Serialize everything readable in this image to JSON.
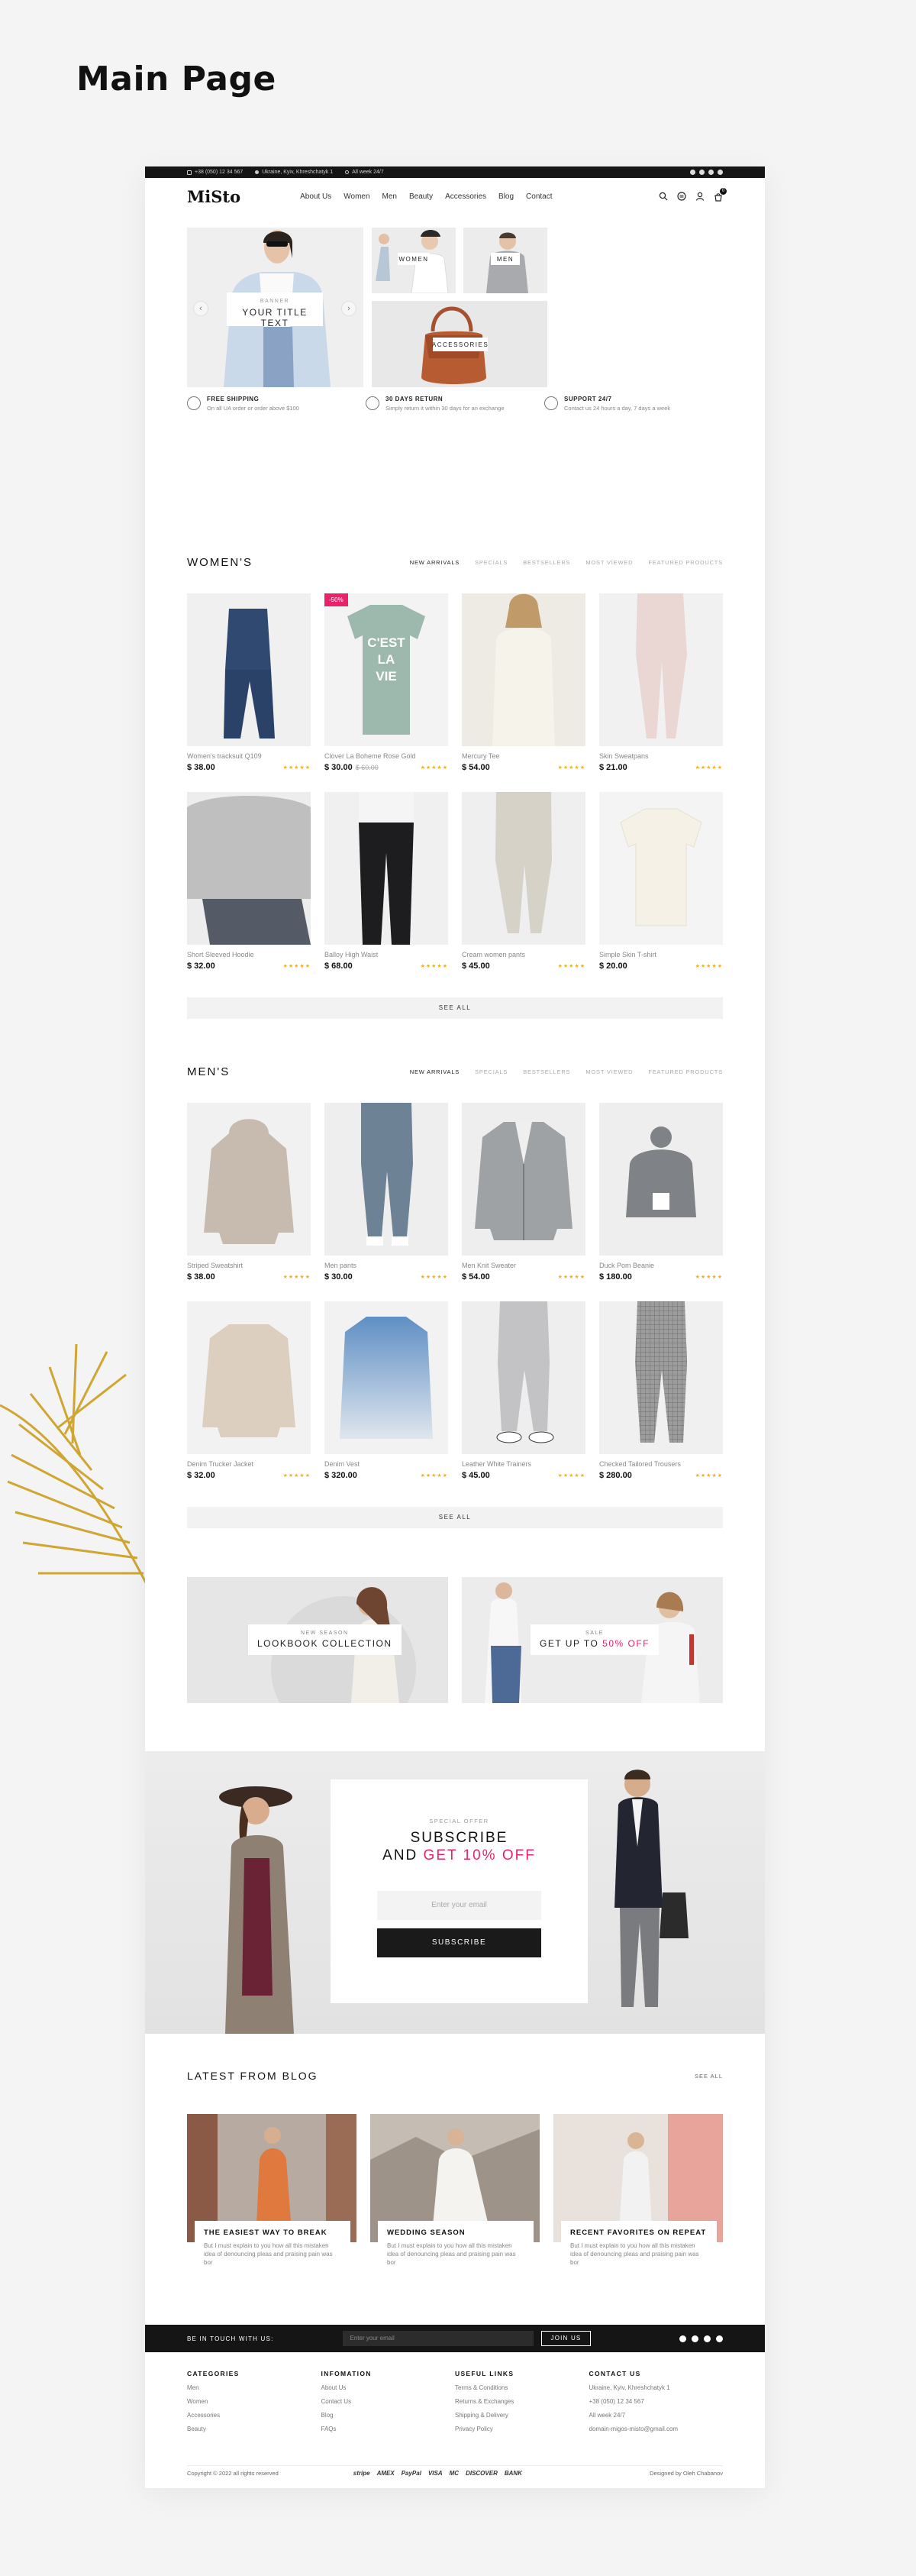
{
  "title": "Main Page",
  "topbar": {
    "phone": "+38 (050) 12 34 567",
    "address": "Ukraine, Kyiv, Khreshchatyk 1",
    "hours": "All week 24/7"
  },
  "header": {
    "logo": "MiSto",
    "nav": [
      "About Us",
      "Women",
      "Men",
      "Beauty",
      "Accessories",
      "Blog",
      "Contact"
    ],
    "cart_count": "0"
  },
  "hero": {
    "banner_sub": "BANNER",
    "banner_title": "YOUR TITLE TEXT",
    "tile_women": "WOMEN",
    "tile_men": "MEN",
    "tile_accessories": "ACCESSORIES",
    "prev": "‹",
    "next": "›"
  },
  "features": [
    {
      "title": "FREE SHIPPING",
      "text": "On all UA order or order above $100"
    },
    {
      "title": "30 DAYS RETURN",
      "text": "Simply return it within 30 days for an exchange"
    },
    {
      "title": "SUPPORT 24/7",
      "text": "Contact us 24 hours a day, 7 days a week"
    }
  ],
  "tabs": [
    "NEW ARRIVALS",
    "SPECIALS",
    "BESTSELLERS",
    "MOST VIEWED",
    "FEATURED PRODUCTS"
  ],
  "women": {
    "heading": "WOMEN'S",
    "see_all": "SEE ALL",
    "products": [
      {
        "name": "Women's tracksuit Q109",
        "price": "$ 38.00",
        "old": "",
        "badge": ""
      },
      {
        "name": "Clover La Boheme Rose Gold",
        "price": "$ 30.00",
        "old": "$ 60.00",
        "badge": "-50%"
      },
      {
        "name": "Mercury Tee",
        "price": "$ 54.00",
        "old": "",
        "badge": ""
      },
      {
        "name": "Skin Sweatpans",
        "price": "$ 21.00",
        "old": "",
        "badge": ""
      },
      {
        "name": "Short Sleeved Hoodie",
        "price": "$ 32.00",
        "old": "",
        "badge": ""
      },
      {
        "name": "Balloy High Waist",
        "price": "$ 68.00",
        "old": "",
        "badge": ""
      },
      {
        "name": "Cream women pants",
        "price": "$ 45.00",
        "old": "",
        "badge": ""
      },
      {
        "name": "Simple Skin T-shirt",
        "price": "$ 20.00",
        "old": "",
        "badge": ""
      }
    ]
  },
  "men": {
    "heading": "MEN'S",
    "see_all": "SEE ALL",
    "products": [
      {
        "name": "Striped Sweatshirt",
        "price": "$ 38.00"
      },
      {
        "name": "Men pants",
        "price": "$ 30.00"
      },
      {
        "name": "Men Knit Sweater",
        "price": "$ 54.00"
      },
      {
        "name": "Duck Pom Beanie",
        "price": "$ 180.00"
      },
      {
        "name": "Denim Trucker Jacket",
        "price": "$ 32.00"
      },
      {
        "name": "Denim Vest",
        "price": "$ 320.00"
      },
      {
        "name": "Leather White Trainers",
        "price": "$ 45.00"
      },
      {
        "name": "Checked Tailored Trousers",
        "price": "$ 280.00"
      }
    ]
  },
  "stars": "★★★★★",
  "promos": {
    "left_sub": "NEW SEASON",
    "left_title": "LOOKBOOK COLLECTION",
    "right_sub": "SALE",
    "right_title": "GET UP TO",
    "right_pct": "50% OFF"
  },
  "subscribe": {
    "sub": "SPECIAL OFFER",
    "line1": "SUBSCRIBE",
    "line2": "AND",
    "pct": "GET 10% OFF",
    "placeholder": "Enter your email",
    "button": "SUBSCRIBE"
  },
  "blog": {
    "heading": "LATEST FROM BLOG",
    "see_all": "SEE ALL",
    "posts": [
      {
        "title": "THE EASIEST WAY TO BREAK",
        "text": "But I must explain to you how all this mistaken idea of denouncing pleas and praising pain was bor"
      },
      {
        "title": "WEDDING SEASON",
        "text": "But I must explain to you how all this mistaken idea of denouncing pleas and praising pain was bor"
      },
      {
        "title": "RECENT FAVORITES ON REPEAT",
        "text": "But I must explain to you how all this mistaken idea of denouncing pleas and praising pain was bor"
      }
    ]
  },
  "touch": {
    "label": "BE IN TOUCH WITH US:",
    "placeholder": "Enter your email",
    "button": "JOIN US"
  },
  "footer": {
    "cols": [
      {
        "title": "CATEGORIES",
        "items": [
          "Men",
          "Women",
          "Accessories",
          "Beauty"
        ]
      },
      {
        "title": "INFOMATION",
        "items": [
          "About Us",
          "Contact Us",
          "Blog",
          "FAQs"
        ]
      },
      {
        "title": "USEFUL LINKS",
        "items": [
          "Terms & Conditions",
          "Returns & Exchanges",
          "Shipping & Delivery",
          "Privacy Policy"
        ]
      },
      {
        "title": "CONTACT US",
        "items": [
          "Ukraine, Kyiv, Khreshchatyk 1",
          "+38 (050) 12 34 567",
          "All week 24/7",
          "domain-migos-misto@gmail.com"
        ]
      }
    ],
    "copyright": "Copyright © 2022 all rights reserved",
    "payments": [
      "stripe",
      "AMEX",
      "PayPal",
      "VISA",
      "MC",
      "DISCOVER",
      "BANK"
    ],
    "designer": "Designed by Oleh Chabanov"
  }
}
